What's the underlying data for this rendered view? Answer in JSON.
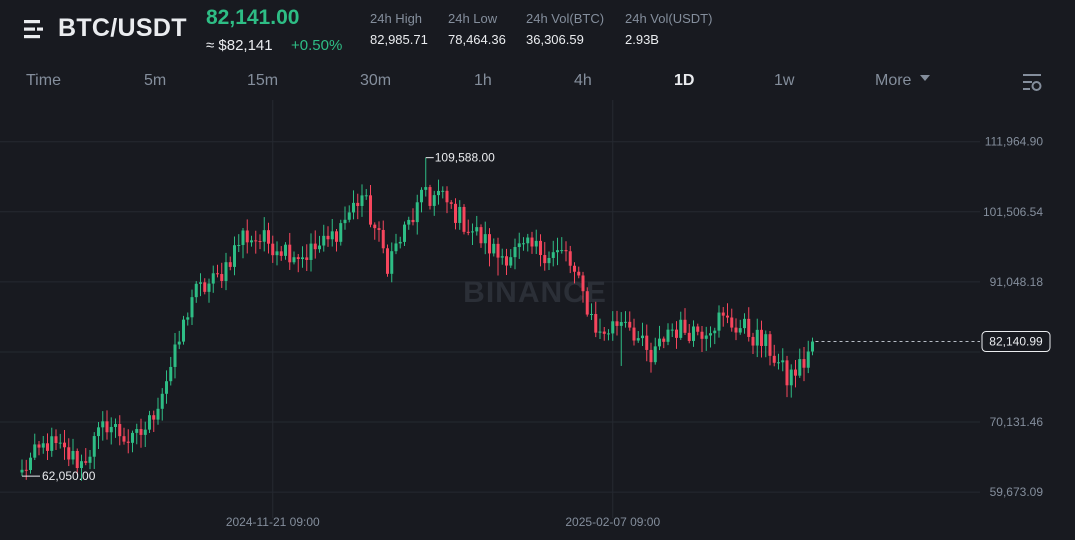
{
  "header": {
    "symbol": "BTC/USDT",
    "price": "82,141.00",
    "usd_price": "≈ $82,141",
    "change": "+0.50%",
    "stats": [
      {
        "label": "24h High",
        "value": "82,985.71"
      },
      {
        "label": "24h Low",
        "value": "78,464.36"
      },
      {
        "label": "24h Vol(BTC)",
        "value": "36,306.59"
      },
      {
        "label": "24h Vol(USDT)",
        "value": "2.93B"
      }
    ]
  },
  "intervals": [
    "Time",
    "5m",
    "15m",
    "30m",
    "1h",
    "4h",
    "1D",
    "1w",
    "More"
  ],
  "active_interval": "1D",
  "icons": {
    "menu": "menu-icon",
    "more_caret": "caret-down-icon",
    "settings": "chart-settings-icon"
  },
  "colors": {
    "up": "#2ebd85",
    "down": "#f6465d",
    "background": "#181a20",
    "text": "#eaecef",
    "muted": "#848e9c"
  },
  "chart_data": {
    "type": "candlestick",
    "watermark": "BINANCE",
    "y_ticks": [
      "111,964.90",
      "101,506.54",
      "91,048.18",
      "70,131.46",
      "59,673.09"
    ],
    "y_tick_values": [
      111964.9,
      101506.54,
      91048.18,
      70131.46,
      59673.09
    ],
    "ylim": [
      57000,
      117000
    ],
    "x_ticks": [
      "2024-11-21 09:00",
      "2025-02-07 09:00"
    ],
    "current_price_label": "82,140.99",
    "current_price": 82140.99,
    "max_label": "109,588.00",
    "max_value": 109588.0,
    "min_label": "62,050.00",
    "min_value": 62050.0,
    "x_tick_indices": [
      59,
      139
    ],
    "max_index": 95,
    "min_index": 0,
    "anchors": [
      [
        0,
        63000
      ],
      [
        6,
        67000
      ],
      [
        14,
        64000
      ],
      [
        20,
        70000
      ],
      [
        26,
        67000
      ],
      [
        30,
        70000
      ],
      [
        36,
        80000
      ],
      [
        40,
        89000
      ],
      [
        46,
        91500
      ],
      [
        52,
        98000
      ],
      [
        58,
        97000
      ],
      [
        66,
        95000
      ],
      [
        72,
        97000
      ],
      [
        80,
        104000
      ],
      [
        86,
        94000
      ],
      [
        94,
        103000
      ],
      [
        98,
        104000
      ],
      [
        104,
        100000
      ],
      [
        112,
        95000
      ],
      [
        120,
        96000
      ],
      [
        128,
        95000
      ],
      [
        136,
        83000
      ],
      [
        142,
        86000
      ],
      [
        148,
        79000
      ],
      [
        152,
        84000
      ],
      [
        160,
        84000
      ],
      [
        164,
        85500
      ],
      [
        170,
        84000
      ],
      [
        176,
        81000
      ],
      [
        180,
        76500
      ],
      [
        184,
        79000
      ],
      [
        186,
        82141
      ]
    ],
    "candle_count": 187
  }
}
